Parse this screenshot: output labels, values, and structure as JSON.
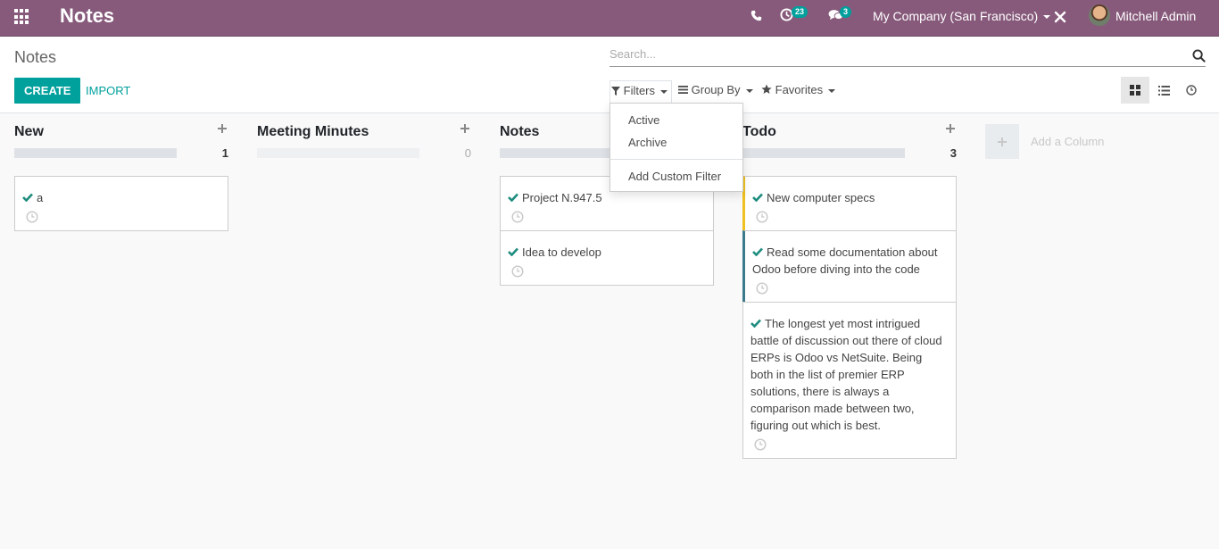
{
  "navbar": {
    "app_title": "Notes",
    "activity_badge": "23",
    "messages_badge": "3",
    "company": "My Company (San Francisco)",
    "user": "Mitchell Admin",
    "color": "#875a7b"
  },
  "control_panel": {
    "breadcrumb": "Notes",
    "search_placeholder": "Search...",
    "create_label": "CREATE",
    "import_label": "IMPORT",
    "filters_label": "Filters",
    "groupby_label": "Group By",
    "favorites_label": "Favorites"
  },
  "filters_menu": {
    "items": [
      "Active",
      "Archive"
    ],
    "custom": "Add Custom Filter"
  },
  "kanban": {
    "accent": "#00a09d",
    "columns": [
      {
        "title": "New",
        "count": "1",
        "cards": [
          {
            "title": "a",
            "highlight": "none"
          }
        ]
      },
      {
        "title": "Meeting Minutes",
        "count": "0",
        "cards": []
      },
      {
        "title": "Notes",
        "count": "",
        "cards": [
          {
            "title": "Project N.947.5",
            "highlight": "none"
          },
          {
            "title": "Idea to develop",
            "highlight": "none"
          }
        ]
      },
      {
        "title": "Todo",
        "count": "3",
        "cards": [
          {
            "title": "New computer specs",
            "highlight": "yellow"
          },
          {
            "title": "Read some documentation about Odoo before diving into the code",
            "highlight": "teal"
          },
          {
            "title": "The longest yet most intrigued battle of discussion out there of cloud ERPs is Odoo vs NetSuite. Being both in the list of premier ERP solutions, there is always a comparison made between two, figuring out which is best.",
            "highlight": "none"
          }
        ]
      }
    ],
    "add_column_label": "Add a Column"
  }
}
